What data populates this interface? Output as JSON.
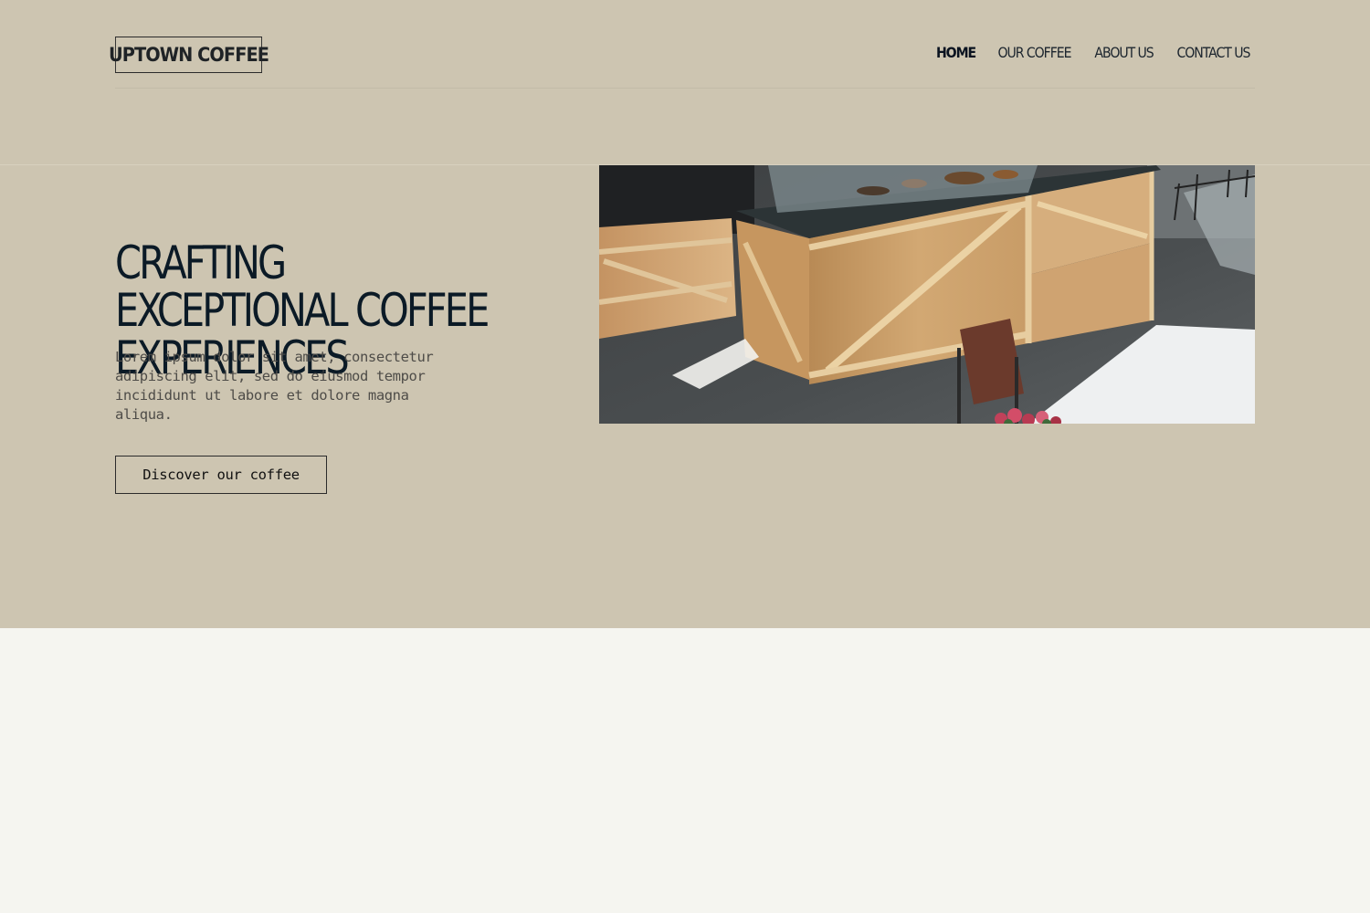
{
  "header": {
    "logo_text": "UPTOWN COFFEE",
    "nav": [
      {
        "label": "HOME",
        "active": true
      },
      {
        "label": "OUR COFFEE",
        "active": false
      },
      {
        "label": "ABOUT US",
        "active": false
      },
      {
        "label": "CONTACT US",
        "active": false
      }
    ]
  },
  "hero": {
    "title": "CRAFTING EXCEPTIONAL COFFEE EXPERIENCES",
    "body": "Lorem ipsum dolor sit amet, consectetur adipiscing elit, sed do eiusmod tempor incididunt ut labore et dolore magna aliqua.",
    "cta_label": "Discover our coffee",
    "image_subject": "cafe-interior-wooden-counter"
  },
  "colors": {
    "band_background": "#cdc5b1",
    "page_background": "#f5f5f0",
    "heading_text": "#0b1a26",
    "body_text": "#4e4c48"
  }
}
